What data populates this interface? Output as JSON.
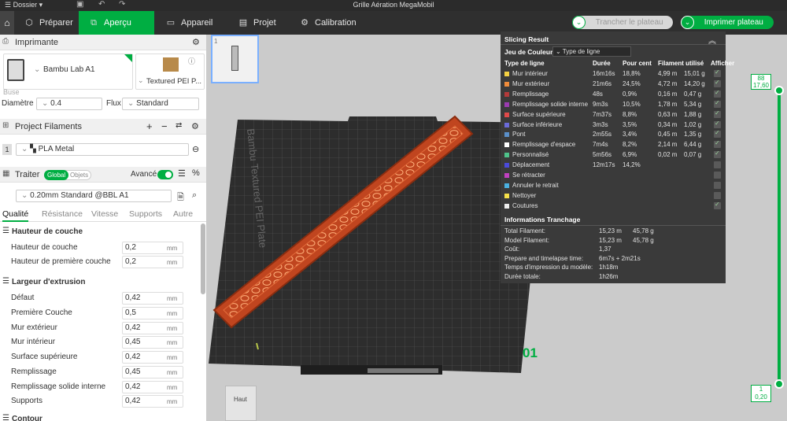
{
  "window": {
    "menu": "Dossier",
    "title": "Grille Aération MegaMobil"
  },
  "tabs": [
    {
      "label": "Préparer"
    },
    {
      "label": "Aperçu"
    },
    {
      "label": "Appareil"
    },
    {
      "label": "Projet"
    },
    {
      "label": "Calibration"
    }
  ],
  "actions": {
    "slice": "Trancher le plateau",
    "print": "Imprimer plateau"
  },
  "printer": {
    "section": "Imprimante",
    "name": "Bambu Lab A1",
    "plate": "Textured PEI P...",
    "buse": "Buse",
    "diameter_label": "Diamètre",
    "diameter": "0.4",
    "flux_label": "Flux",
    "flux": "Standard"
  },
  "filaments": {
    "section": "Project Filaments",
    "index": "1",
    "name": "PLA Metal"
  },
  "process": {
    "section": "Traiter",
    "global": "Global",
    "objets": "Objets",
    "avance": "Avancé",
    "profile": "0.20mm Standard @BBL A1",
    "subtabs": [
      "Qualité",
      "Résistance",
      "Vitesse",
      "Supports",
      "Autre"
    ],
    "group1": "Hauteur de couche",
    "layer": [
      {
        "label": "Hauteur de couche",
        "value": "0,2",
        "unit": "mm"
      },
      {
        "label": "Hauteur de première couche",
        "value": "0,2",
        "unit": "mm"
      }
    ],
    "group2": "Largeur d'extrusion",
    "width": [
      {
        "label": "Défaut",
        "value": "0,42",
        "unit": "mm"
      },
      {
        "label": "Première Couche",
        "value": "0,5",
        "unit": "mm"
      },
      {
        "label": "Mur extérieur",
        "value": "0,42",
        "unit": "mm"
      },
      {
        "label": "Mur intérieur",
        "value": "0,45",
        "unit": "mm"
      },
      {
        "label": "Surface supérieure",
        "value": "0,42",
        "unit": "mm"
      },
      {
        "label": "Remplissage",
        "value": "0,45",
        "unit": "mm"
      },
      {
        "label": "Remplissage solide interne",
        "value": "0,42",
        "unit": "mm"
      },
      {
        "label": "Supports",
        "value": "0,42",
        "unit": "mm"
      }
    ],
    "group3": "Contour"
  },
  "bed": {
    "label": "Bambu Textured PEI Plate",
    "number": "01"
  },
  "viewcube": "Haut",
  "layers": {
    "top_layer": "88",
    "top_height": "17,60",
    "bottom_layer": "1",
    "bottom_height": "0,20"
  },
  "result": {
    "title": "Slicing Result",
    "jeu_label": "Jeu de Couleur",
    "jeu_value": "Type de ligne",
    "headers": [
      "Type de ligne",
      "Durée",
      "Pour cent",
      "Filament utilisé",
      "Afficher"
    ],
    "rows": [
      {
        "name": "Mur intérieur",
        "color": "#f5d142",
        "time": "16m16s",
        "pct": "18,8%",
        "fil": "4,99 m",
        "g": "15,01 g",
        "show": true
      },
      {
        "name": "Mur extérieur",
        "color": "#f08c3b",
        "time": "21m6s",
        "pct": "24,5%",
        "fil": "4,72 m",
        "g": "14,20 g",
        "show": true
      },
      {
        "name": "Remplissage",
        "color": "#b33a3a",
        "time": "48s",
        "pct": "0,9%",
        "fil": "0,16 m",
        "g": "0,47 g",
        "show": true
      },
      {
        "name": "Remplissage solide interne",
        "color": "#9b3bb0",
        "time": "9m3s",
        "pct": "10,5%",
        "fil": "1,78 m",
        "g": "5,34 g",
        "show": true
      },
      {
        "name": "Surface supérieure",
        "color": "#e04a4a",
        "time": "7m37s",
        "pct": "8,8%",
        "fil": "0,63 m",
        "g": "1,88 g",
        "show": true
      },
      {
        "name": "Surface inférieure",
        "color": "#6a6ad9",
        "time": "3m3s",
        "pct": "3,5%",
        "fil": "0,34 m",
        "g": "1,02 g",
        "show": true
      },
      {
        "name": "Pont",
        "color": "#5a8fc9",
        "time": "2m55s",
        "pct": "3,4%",
        "fil": "0,45 m",
        "g": "1,35 g",
        "show": true
      },
      {
        "name": "Remplissage d'espace",
        "color": "#ffffff",
        "time": "7m4s",
        "pct": "8,2%",
        "fil": "2,14 m",
        "g": "6,44 g",
        "show": true
      },
      {
        "name": "Personnalisé",
        "color": "#4ec28a",
        "time": "5m56s",
        "pct": "6,9%",
        "fil": "0,02 m",
        "g": "0,07 g",
        "show": true
      },
      {
        "name": "Déplacement",
        "color": "#4a4ad9",
        "time": "12m17s",
        "pct": "14,2%",
        "fil": "",
        "g": "",
        "show": false
      },
      {
        "name": "Se rétracter",
        "color": "#c040c0",
        "time": "",
        "pct": "",
        "fil": "",
        "g": "",
        "show": false
      },
      {
        "name": "Annuler le retrait",
        "color": "#4ab0e0",
        "time": "",
        "pct": "",
        "fil": "",
        "g": "",
        "show": false
      },
      {
        "name": "Nettoyer",
        "color": "#f5e04a",
        "time": "",
        "pct": "",
        "fil": "",
        "g": "",
        "show": false
      },
      {
        "name": "Coutures",
        "color": "#eeeeee",
        "time": "",
        "pct": "",
        "fil": "",
        "g": "",
        "show": true
      }
    ],
    "info_title": "Informations Tranchage",
    "info": [
      {
        "k": "Total Filament:",
        "v": "15,23 m",
        "w": "45,78 g"
      },
      {
        "k": "Model Filament:",
        "v": "15,23 m",
        "w": "45,78 g"
      },
      {
        "k": "Coût:",
        "v": "1,37",
        "w": ""
      },
      {
        "k": "Prepare and timelapse time:",
        "v": "6m7s + 2m21s",
        "w": ""
      },
      {
        "k": "Temps d'impression du modèle:",
        "v": "1h18m",
        "w": ""
      },
      {
        "k": "Durée totale:",
        "v": "1h26m",
        "w": ""
      }
    ]
  }
}
